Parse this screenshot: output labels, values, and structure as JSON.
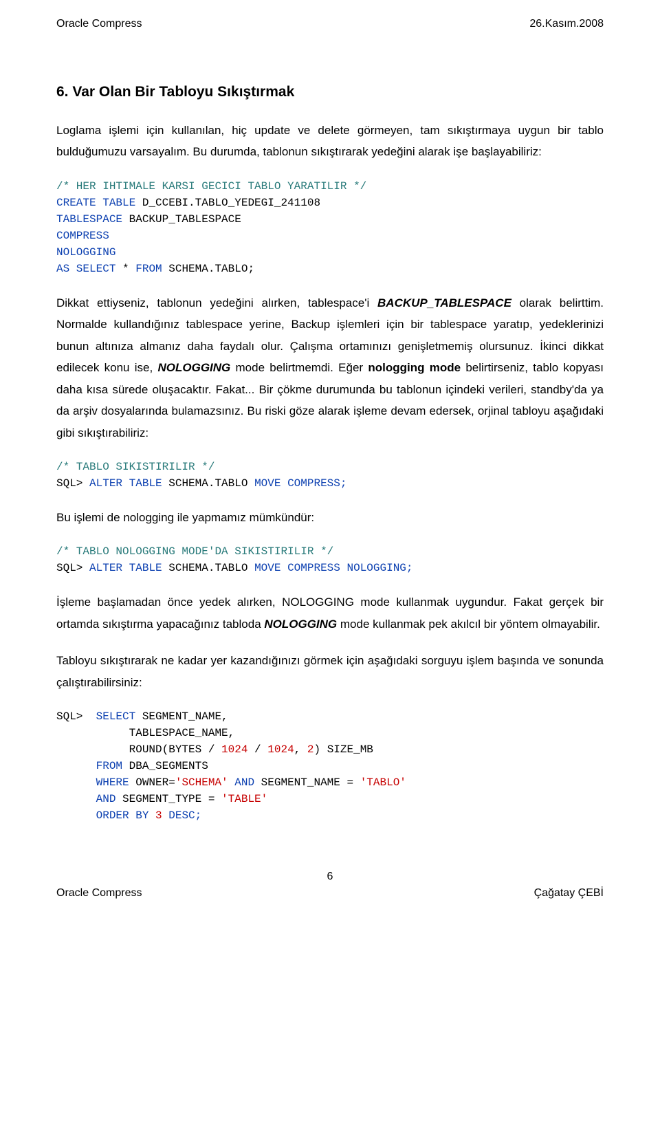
{
  "header": {
    "left": "Oracle Compress",
    "right": "26.Kasım.2008"
  },
  "heading": "6. Var Olan Bir Tabloyu Sıkıştırmak",
  "para1": "Loglama işlemi için kullanılan, hiç update ve delete görmeyen, tam sıkıştırmaya uygun bir tablo bulduğumuzu varsayalım. Bu durumda, tablonun sıkıştırarak yedeğini alarak işe başlayabiliriz:",
  "code1": {
    "c1": "/* HER IHTIMALE KARSI GECICI TABLO YARATILIR */",
    "l1a": "CREATE",
    "l1b": " TABLE",
    "l1c": " D_CCEBI.TABLO_YEDEGI_241108",
    "l2a": "TABLESPACE",
    "l2b": " BACKUP_TABLESPACE",
    "l3": "COMPRESS",
    "l4": "NOLOGGING",
    "l5a": "AS",
    "l5b": " SELECT",
    "l5c": " * ",
    "l5d": "FROM",
    "l5e": " SCHEMA.TABLO;"
  },
  "para2a": "Dikkat ettiyseniz, tablonun yedeğini alırken, tablespace'i ",
  "para2_bold1": "BACKUP_TABLESPACE",
  "para2b": " olarak belirttim. Normalde kullandığınız tablespace yerine, Backup işlemleri için bir tablespace yaratıp, yedeklerinizi bunun altınıza almanız daha faydalı olur. Çalışma ortamınızı genişletmemiş olursunuz. İkinci dikkat edilecek konu ise, ",
  "para2_bold2": "NOLOGGING",
  "para2c": " mode belirtmemdi. Eğer ",
  "para2_bold3": "nologging mode",
  "para2d": " belirtirseniz, tablo kopyası daha kısa sürede oluşacaktır. Fakat... Bir çökme durumunda bu tablonun içindeki verileri, standby'da ya da arşiv dosyalarında bulamazsınız. Bu riski göze alarak işleme devam edersek, orjinal tabloyu aşağıdaki gibi sıkıştırabiliriz:",
  "code2": {
    "c1": "/* TABLO SIKISTIRILIR */",
    "l1a": "SQL> ",
    "l1b": "ALTER",
    "l1c": " TABLE",
    "l1d": " SCHEMA.TABLO ",
    "l1e": "MOVE",
    "l1f": " COMPRESS;"
  },
  "para3": "Bu işlemi de nologging ile yapmamız mümkündür:",
  "code3": {
    "c1": "/* TABLO NOLOGGING MODE'DA SIKISTIRILIR */",
    "l1a": "SQL> ",
    "l1b": "ALTER",
    "l1c": " TABLE",
    "l1d": " SCHEMA.TABLO ",
    "l1e": "MOVE",
    "l1f": " COMPRESS",
    "l1g": " NOLOGGING;"
  },
  "para4a": "İşleme başlamadan önce yedek alırken, NOLOGGING mode kullanmak uygundur. Fakat gerçek bir ortamda sıkıştırma yapacağınız tabloda ",
  "para4_bold1": "NOLOGGING",
  "para4b": " mode kullanmak pek akılcıl bir yöntem olmayabilir.",
  "para5": "Tabloyu sıkıştırarak ne kadar yer kazandığınızı görmek için aşağıdaki sorguyu işlem başında ve sonunda çalıştırabilirsiniz:",
  "code4": {
    "l1a": "SQL>  ",
    "l1b": "SELECT",
    "l1c": " SEGMENT_NAME,",
    "l2": "           TABLESPACE_NAME,",
    "l3a": "           ROUND(BYTES / ",
    "l3b": "1024",
    "l3c": " / ",
    "l3d": "1024",
    "l3e": ", ",
    "l3f": "2",
    "l3g": ") SIZE_MB",
    "l4a": "      FROM",
    "l4b": " DBA_SEGMENTS",
    "l5a": "      WHERE",
    "l5b": " OWNER=",
    "l5c": "'SCHEMA'",
    "l5d": " AND",
    "l5e": " SEGMENT_NAME = ",
    "l5f": "'TABLO'",
    "l6a": "      AND",
    "l6b": " SEGMENT_TYPE = ",
    "l6c": "'TABLE'",
    "l7a": "      ORDER",
    "l7b": " BY",
    "l7c": " 3",
    "l7d": " DESC;"
  },
  "page_number": "6",
  "footer": {
    "left": "Oracle Compress",
    "right": "Çağatay ÇEBİ"
  }
}
